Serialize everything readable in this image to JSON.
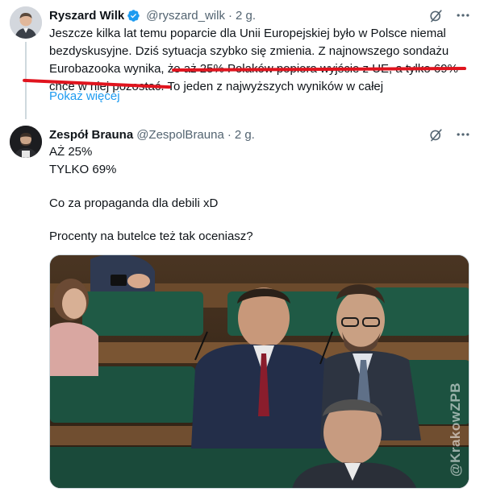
{
  "tweets": [
    {
      "author": {
        "name": "Ryszard Wilk",
        "handle": "@ryszard_wilk",
        "verified": true
      },
      "time": "2 g.",
      "text_lines": [
        "Jeszcze kilka lat temu poparcie dla Unii Europejskiej było w Polsce niemal",
        "bezdyskusyjne. Dziś sytuacja szybko się zmienia. Z najnowszego sondażu",
        "Eurobazooka wynika, że aż 25% Polaków popiera wyjście z UE, a tylko 69%",
        "chce w niej pozostać. To jeden z najwyższych wyników w całej"
      ],
      "show_more": "Pokaż więcej"
    },
    {
      "author": {
        "name": "Zespół Brauna",
        "handle": "@ZespolBrauna",
        "verified": false
      },
      "time": "2 g.",
      "lines": [
        "AŻ 25%",
        "TYLKO 69%",
        "Co za propaganda dla debili xD",
        "Procenty na butelce też tak oceniasz?"
      ],
      "media": {
        "watermark": "@KrakowZPB"
      }
    }
  ],
  "colors": {
    "accent": "#1d9bf0",
    "underline": "#e0141e",
    "muted": "#536471"
  },
  "icons": [
    "verified-badge-icon",
    "grok-icon",
    "more-icon"
  ]
}
